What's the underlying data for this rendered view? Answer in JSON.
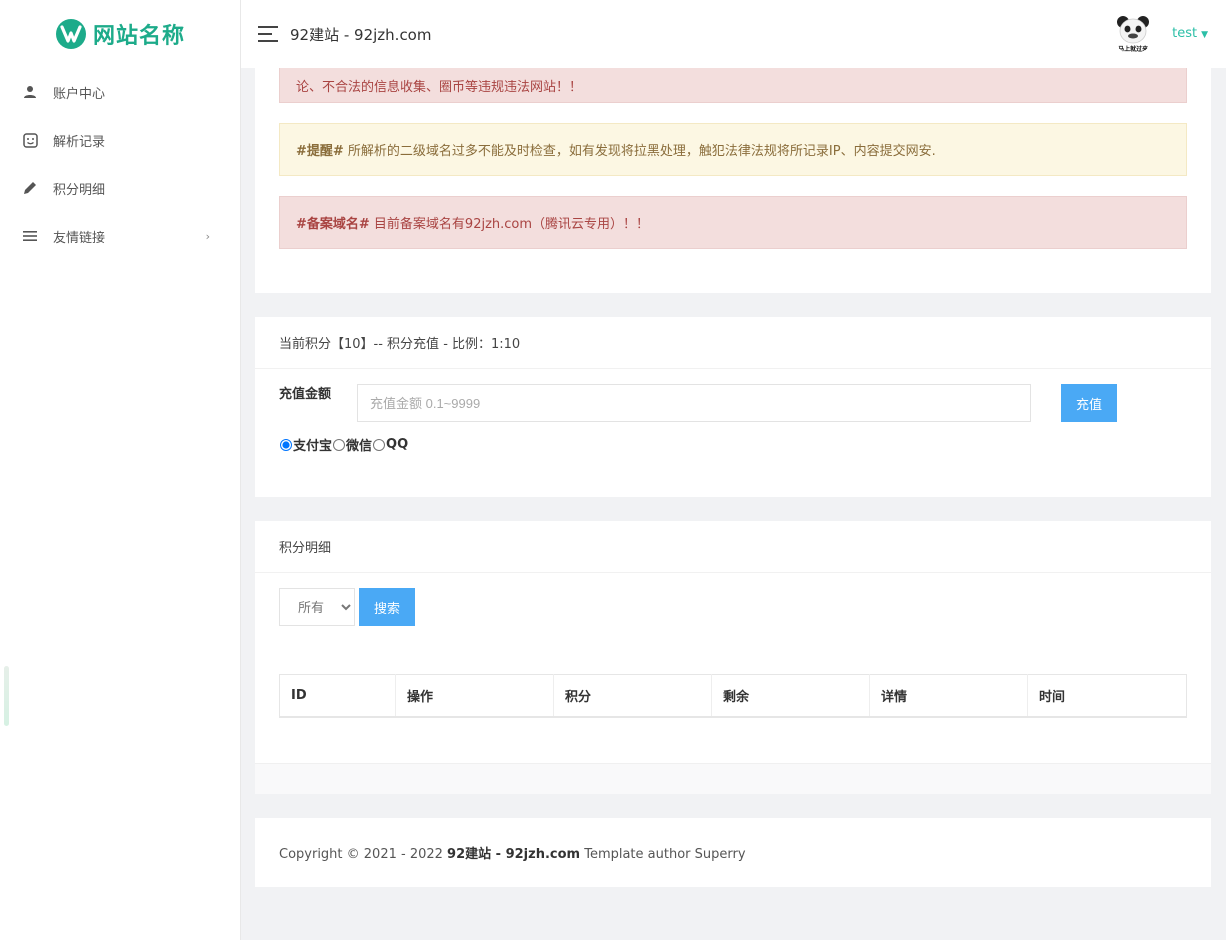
{
  "brand": {
    "logo_text": "网站名称",
    "accent": "#1dab8a"
  },
  "sidebar": {
    "items": [
      {
        "label": "账户中心",
        "icon": "user-icon"
      },
      {
        "label": "解析记录",
        "icon": "smile-square-icon"
      },
      {
        "label": "积分明细",
        "icon": "pencil-icon"
      },
      {
        "label": "友情链接",
        "icon": "menu-lines-icon",
        "has_submenu": true
      }
    ]
  },
  "header": {
    "title": "92建站 - 92jzh.com",
    "user": {
      "name": "test",
      "avatar_caption": "马上就过来"
    }
  },
  "notices": {
    "alert1": "论、不合法的信息收集、圈币等违规违法网站！！",
    "alert2_tag": "#提醒#",
    "alert2_text": " 所解析的二级域名过多不能及时检查，如有发现将拉黑处理，触犯法律法规将所记录IP、内容提交网安.",
    "alert3_tag": "#备案域名#",
    "alert3_text": " 目前备案域名有92jzh.com（腾讯云专用）！！"
  },
  "recharge": {
    "title": "当前积分【10】-- 积分充值 - 比例：1:10",
    "amount_label": "充值金额",
    "amount_placeholder": "充值金额 0.1~9999",
    "amount_value": "",
    "button": "充值",
    "methods": [
      {
        "label": "支付宝",
        "checked": true
      },
      {
        "label": "微信",
        "checked": false
      },
      {
        "label": "QQ",
        "checked": false
      }
    ]
  },
  "log": {
    "title": "积分明细",
    "filter_selected": "所有",
    "search_button": "搜索",
    "columns": [
      "ID",
      "操作",
      "积分",
      "剩余",
      "详情",
      "时间"
    ],
    "rows": []
  },
  "footer": {
    "prefix": "Copyright © 2021 - 2022 ",
    "site": "92建站 - 92jzh.com",
    "suffix": " Template author Superry"
  }
}
